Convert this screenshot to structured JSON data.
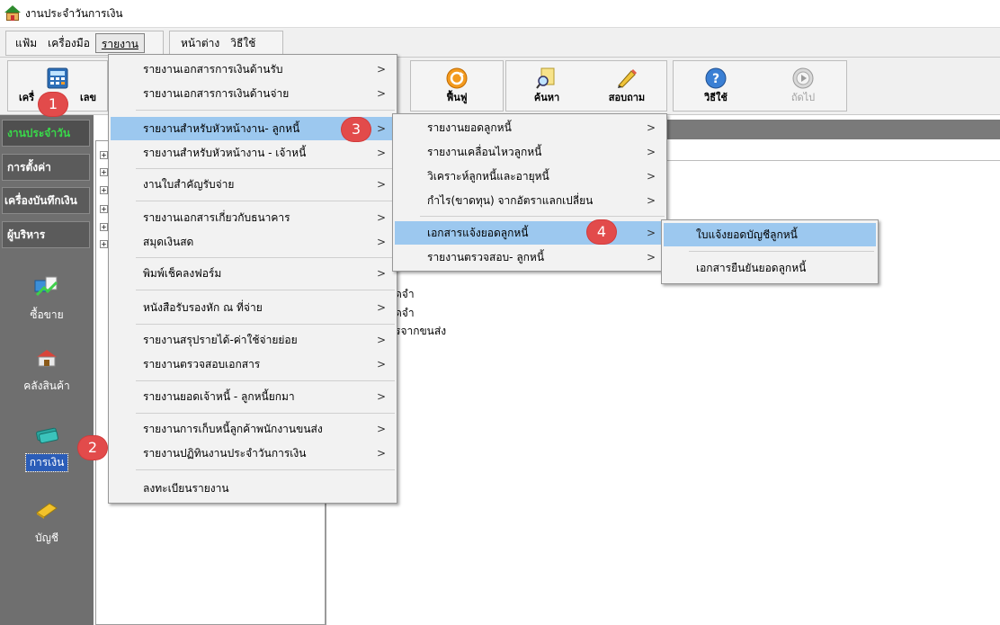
{
  "window": {
    "title": "งานประจำวันการเงิน"
  },
  "menubar": {
    "group1": [
      "แฟ้ม",
      "เครื่องมือ",
      "รายงาน"
    ],
    "group2": [
      "หน้าต่าง",
      "วิธีใช้"
    ]
  },
  "toolbar": {
    "calculator_label_left": "เครื่",
    "calculator_label_right": "เลข",
    "refresh": "ฟื้นฟู",
    "search": "ค้นหา",
    "query": "สอบถาม",
    "help": "วิธีใช้",
    "next": "ถัดไป"
  },
  "leftnav": {
    "tabs": [
      "งานประจำวัน",
      "การตั้งค่า",
      "เครื่องบันทึกเงิน",
      "ผู้บริหาร"
    ],
    "modules": [
      "ซื้อขาย",
      "คลังสินค้า",
      "การเงิน",
      "บัญชี"
    ]
  },
  "menu_report": {
    "items": [
      "รายงานเอกสารการเงินด้านรับ",
      "รายงานเอกสารการเงินด้านจ่าย",
      "รายงานสำหรับหัวหน้างาน- ลูกหนี้",
      "รายงานสำหรับหัวหน้างาน - เจ้าหนี้",
      "งานใบสำคัญรับจ่าย",
      "รายงานเอกสารเกี่ยวกับธนาคาร",
      "สมุดเงินสด",
      "พิมพ์เช็คลงฟอร์ม",
      "หนังสือรับรองหัก ณ ที่จ่าย",
      "รายงานสรุปรายได้-ค่าใช้จ่ายย่อย",
      "รายงานตรวจสอบเอกสาร",
      "รายงานยอดเจ้าหนี้  - ลูกหนี้ยกมา",
      "รายงานการเก็บหนี้ลูกค้าพนักงานขนส่ง",
      "รายงานปฏิทินงานประจำวันการเงิน",
      "ลงทะเบียนรายงาน"
    ]
  },
  "menu_debtor": {
    "items": [
      "รายงานยอดลูกหนี้",
      "รายงานเคลื่อนไหวลูกหนี้",
      "วิเคราะห์ลูกหนี้และอายุหนี้",
      "กำไร(ขาดทุน) จากอัตราแลกเปลี่ยน",
      "เอกสารแจ้งยอดลูกหนี้",
      "รายงานตรวจสอบ- ลูกหนี้"
    ]
  },
  "menu_statement": {
    "items": [
      "ใบแจ้งยอดบัญชีลูกหนี้",
      "เอกสารยืนยันยอดลูกหนี้"
    ]
  },
  "main_fragments": [
    "ัดจำ",
    "ัดจำ",
    "รจากขนส่ง"
  ],
  "callouts": [
    "1",
    "2",
    "3",
    "4"
  ]
}
